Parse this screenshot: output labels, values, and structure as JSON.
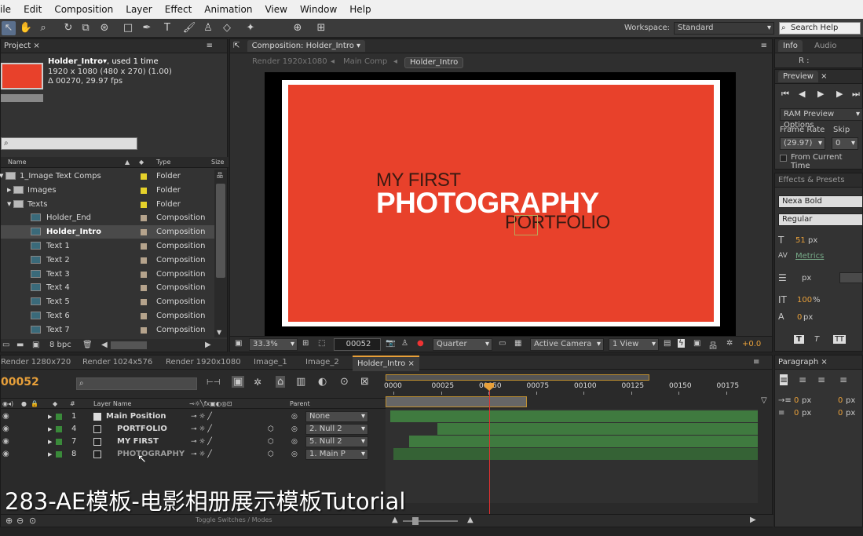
{
  "menu": [
    "ile",
    "Edit",
    "Composition",
    "Layer",
    "Effect",
    "Animation",
    "View",
    "Window",
    "Help"
  ],
  "toolbar": {
    "workspace_label": "Workspace:",
    "workspace_value": "Standard",
    "search_help": "Search Help"
  },
  "project": {
    "tab": "Project",
    "selected_name": "Holder_Intro▾",
    "used": ", used 1 time",
    "dims": "1920 x 1080  (480 x 270) (1.00)",
    "duration": "Δ 00270, 29.97 fps",
    "col_name": "Name",
    "col_type": "Type",
    "col_size": "Size",
    "items": [
      {
        "label": "1_Image Text Comps",
        "type": "Folder",
        "kind": "folder",
        "indent": 0,
        "swatch": "#e6d22a"
      },
      {
        "label": "Images",
        "type": "Folder",
        "kind": "folder",
        "indent": 1,
        "swatch": "#e6d22a"
      },
      {
        "label": "Texts",
        "type": "Folder",
        "kind": "folder",
        "indent": 1,
        "swatch": "#e6d22a"
      },
      {
        "label": "Holder_End",
        "type": "Composition",
        "kind": "comp",
        "indent": 2,
        "swatch": "#b5a38c"
      },
      {
        "label": "Holder_Intro",
        "type": "Composition",
        "kind": "comp",
        "indent": 2,
        "swatch": "#b5a38c",
        "selected": true
      },
      {
        "label": "Text 1",
        "type": "Composition",
        "kind": "comp",
        "indent": 2,
        "swatch": "#b5a38c"
      },
      {
        "label": "Text 2",
        "type": "Composition",
        "kind": "comp",
        "indent": 2,
        "swatch": "#b5a38c"
      },
      {
        "label": "Text 3",
        "type": "Composition",
        "kind": "comp",
        "indent": 2,
        "swatch": "#b5a38c"
      },
      {
        "label": "Text 4",
        "type": "Composition",
        "kind": "comp",
        "indent": 2,
        "swatch": "#b5a38c"
      },
      {
        "label": "Text 5",
        "type": "Composition",
        "kind": "comp",
        "indent": 2,
        "swatch": "#b5a38c"
      },
      {
        "label": "Text 6",
        "type": "Composition",
        "kind": "comp",
        "indent": 2,
        "swatch": "#b5a38c"
      },
      {
        "label": "Text 7",
        "type": "Composition",
        "kind": "comp",
        "indent": 2,
        "swatch": "#b5a38c"
      }
    ],
    "bpc": "8 bpc"
  },
  "comp": {
    "tab": "Composition: Holder_Intro",
    "breadcrumbs": [
      "Render 1920x1080",
      "Main Comp",
      "Holder_Intro"
    ],
    "line1": "MY FIRST",
    "line2": "PHOTOGRAPHY",
    "line3": "PORTFOLIO",
    "zoom": "33.3%",
    "timecode": "00052",
    "resolution": "Quarter",
    "camera": "Active Camera",
    "view": "1 View",
    "exposure": "+0.0"
  },
  "info": {
    "tab_info": "Info",
    "tab_audio": "Audio",
    "r": "R :"
  },
  "preview": {
    "tab": "Preview",
    "ram": "RAM Preview Options",
    "frame_rate_label": "Frame Rate",
    "skip_label": "Skip",
    "frame_rate": "(29.97)",
    "skip": "0",
    "from_current": "From Current Time"
  },
  "effects": {
    "tab": "Effects & Presets"
  },
  "character": {
    "font": "Nexa Bold",
    "style": "Regular",
    "size": "51",
    "size_unit": "px",
    "kerning": "Metrics",
    "leading_unit": "px",
    "vscale": "100",
    "vscale_unit": "%",
    "baseline": "0",
    "baseline_unit": "px"
  },
  "paragraph": {
    "tab": "Paragraph",
    "v1": "0",
    "v2": "0",
    "v3": "0",
    "v4": "0",
    "unit": "px"
  },
  "timeline": {
    "tabs": [
      "Render 1280x720",
      "Render 1024x576",
      "Render 1920x1080",
      "Image_1",
      "Image_2",
      "Holder_Intro"
    ],
    "timecode": "00052",
    "col_hash": "#",
    "col_layer": "Layer Name",
    "col_parent": "Parent",
    "ticks": [
      "0000",
      "00025",
      "00050",
      "00075",
      "00100",
      "00125",
      "00150",
      "00175"
    ],
    "layers": [
      {
        "num": "1",
        "name": "Main Position",
        "parent": "None",
        "type": "null"
      },
      {
        "num": "4",
        "name": "PORTFOLIO",
        "parent": "2. Null 2",
        "type": "text"
      },
      {
        "num": "7",
        "name": "MY FIRST",
        "parent": "5. Null 2",
        "type": "text"
      },
      {
        "num": "8",
        "name": "PHOTOGRAPHY",
        "parent": "1. Main P",
        "type": "text"
      }
    ],
    "toggle": "Toggle Switches / Modes"
  },
  "subtitle": "283-AE模板-电影相册展示模板Tutorial",
  "colors": {
    "accent": "#e8412b",
    "timecode": "#e8a03a",
    "bar": "#3f7a3f"
  }
}
